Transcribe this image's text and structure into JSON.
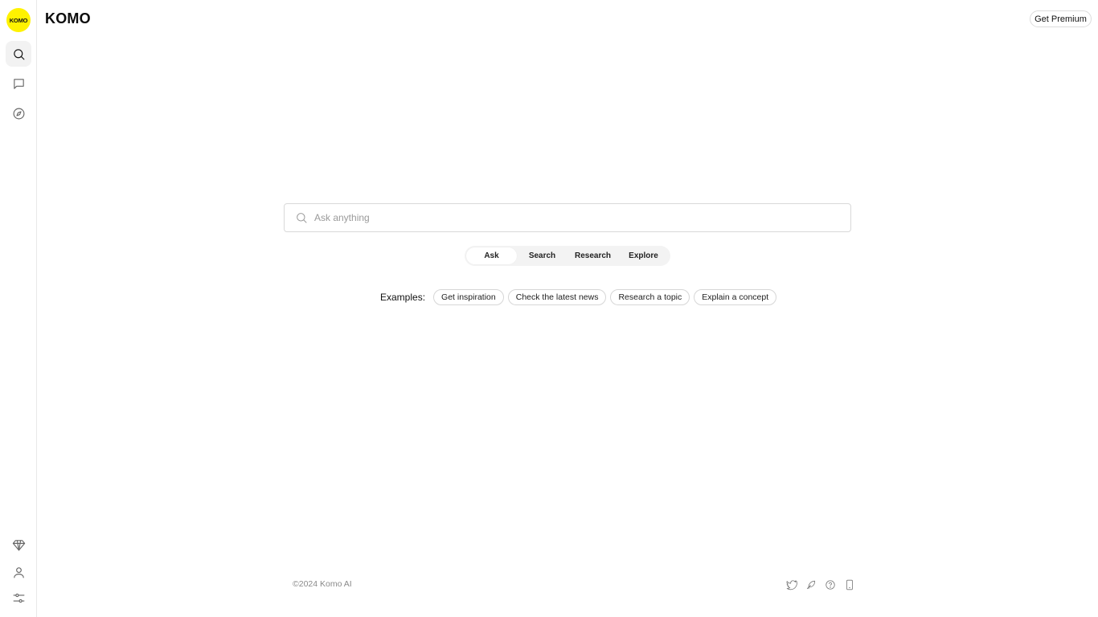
{
  "brand": {
    "badge_text": "KOMO",
    "name": "KOMO"
  },
  "header": {
    "premium_label": "Get Premium"
  },
  "sidebar": {
    "top_items": [
      {
        "icon": "search-icon",
        "active": true
      },
      {
        "icon": "chat-icon",
        "active": false
      },
      {
        "icon": "compass-icon",
        "active": false
      }
    ],
    "bottom_items": [
      {
        "icon": "diamond-icon"
      },
      {
        "icon": "user-icon"
      },
      {
        "icon": "settings-sliders-icon"
      }
    ]
  },
  "search": {
    "placeholder": "Ask anything",
    "value": ""
  },
  "modes": {
    "tabs": [
      "Ask",
      "Search",
      "Research",
      "Explore"
    ],
    "selected": "Ask"
  },
  "examples": {
    "label": "Examples:",
    "chips": [
      "Get inspiration",
      "Check the latest news",
      "Research a topic",
      "Explain a concept"
    ]
  },
  "footer": {
    "copyright": "©2024 Komo AI",
    "icons": [
      "twitter-icon",
      "feather-icon",
      "help-icon",
      "mobile-icon"
    ]
  },
  "colors": {
    "badge_yellow": "#fff200",
    "border": "#d9d9d9",
    "muted_text": "#8a8a8a"
  }
}
